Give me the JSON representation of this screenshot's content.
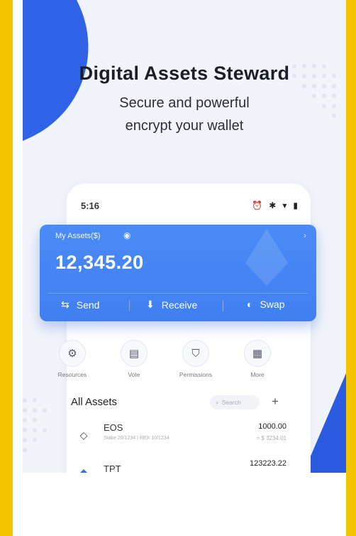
{
  "promo": {
    "headline": "Digital Assets Steward",
    "subline1": "Secure and powerful",
    "subline2": "encrypt your wallet"
  },
  "phone": {
    "status_time": "5:16",
    "status_icons": [
      "alarm-icon",
      "bluetooth-icon",
      "wifi-icon",
      "battery-icon"
    ]
  },
  "wallet_card": {
    "label": "My Assets($)",
    "amount": "12,345.20",
    "actions": [
      {
        "label": "Send",
        "icon": "send-icon"
      },
      {
        "label": "Receive",
        "icon": "receive-icon"
      },
      {
        "label": "Swap",
        "icon": "swap-icon"
      }
    ]
  },
  "shortcuts": [
    {
      "label": "Resources",
      "icon": "resources-icon"
    },
    {
      "label": "Vote",
      "icon": "vote-icon"
    },
    {
      "label": "Permissions",
      "icon": "permissions-icon"
    },
    {
      "label": "More",
      "icon": "more-grid-icon"
    }
  ],
  "assets": {
    "title": "All Assets",
    "search_placeholder": "Search",
    "rows": [
      {
        "name": "EOS",
        "meta": "Stake 20/1234  |  REX 10/1234",
        "balance": "1000.00",
        "fiat": "≈ $ 3234.01"
      },
      {
        "name": "TPT",
        "meta": "",
        "balance": "123223.22",
        "fiat": ""
      }
    ]
  },
  "colors": {
    "frame": "#f4c400",
    "accent_blue": "#3f7ff0",
    "background": "#f1f4fa"
  }
}
